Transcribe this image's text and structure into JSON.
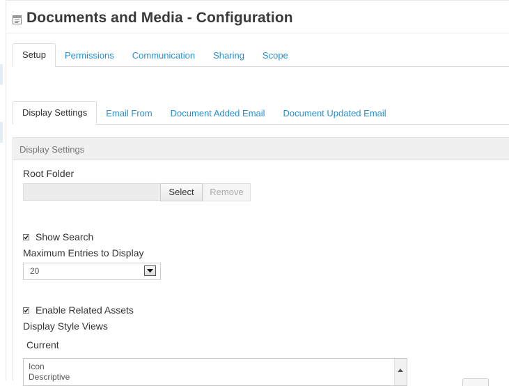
{
  "page": {
    "title": "Documents and Media - Configuration"
  },
  "tabs_main": [
    {
      "label": "Setup",
      "active": true
    },
    {
      "label": "Permissions",
      "active": false
    },
    {
      "label": "Communication",
      "active": false
    },
    {
      "label": "Sharing",
      "active": false
    },
    {
      "label": "Scope",
      "active": false
    }
  ],
  "tabs_sub": [
    {
      "label": "Display Settings",
      "active": true
    },
    {
      "label": "Email From",
      "active": false
    },
    {
      "label": "Document Added Email",
      "active": false
    },
    {
      "label": "Document Updated Email",
      "active": false
    }
  ],
  "panel": {
    "heading": "Display Settings"
  },
  "root_folder": {
    "label": "Root Folder",
    "value": "",
    "select_label": "Select",
    "remove_label": "Remove"
  },
  "show_search": {
    "label": "Show Search",
    "checked": true
  },
  "max_entries": {
    "label": "Maximum Entries to Display",
    "value": "20"
  },
  "related_assets": {
    "label": "Enable Related Assets",
    "checked": true
  },
  "display_style": {
    "label": "Display Style Views",
    "current_label": "Current",
    "current_items": [
      "Icon",
      "Descriptive"
    ]
  },
  "colors": {
    "link": "#2a8fd0",
    "text": "#333333",
    "panel_header": "#f0f0f0"
  },
  "icons": {
    "title": "portlet-config-icon",
    "checkbox": "checkbox-checked-icon",
    "dropdown": "dropdown-arrow-icon",
    "scroll": "scroll-up-arrow-icon"
  }
}
